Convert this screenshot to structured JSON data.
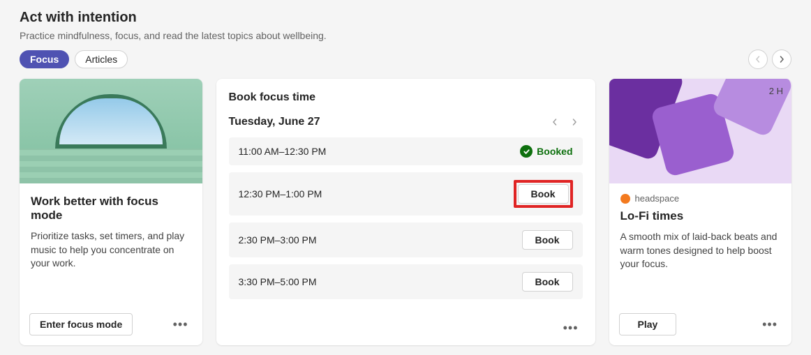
{
  "header": {
    "title": "Act with intention",
    "subtitle": "Practice mindfulness, focus, and read the latest topics about wellbeing."
  },
  "tabs": {
    "focus": "Focus",
    "articles": "Articles"
  },
  "focus_card": {
    "title": "Work better with focus mode",
    "description": "Prioritize tasks, set timers, and play music to help you concentrate on your work.",
    "action": "Enter focus mode"
  },
  "book_card": {
    "title": "Book focus time",
    "date": "Tuesday, June 27",
    "booked_label": "Booked",
    "book_label": "Book",
    "slots": [
      {
        "time": "11:00 AM–12:30 PM",
        "status": "booked"
      },
      {
        "time": "12:30 PM–1:00 PM",
        "status": "available",
        "highlighted": true
      },
      {
        "time": "2:30 PM–3:00 PM",
        "status": "available"
      },
      {
        "time": "3:30 PM–5:00 PM",
        "status": "available"
      }
    ]
  },
  "lofi_card": {
    "duration": "2 H",
    "brand": "headspace",
    "title": "Lo-Fi times",
    "description": "A smooth mix of laid-back beats and warm tones designed to help boost your focus.",
    "action": "Play"
  }
}
